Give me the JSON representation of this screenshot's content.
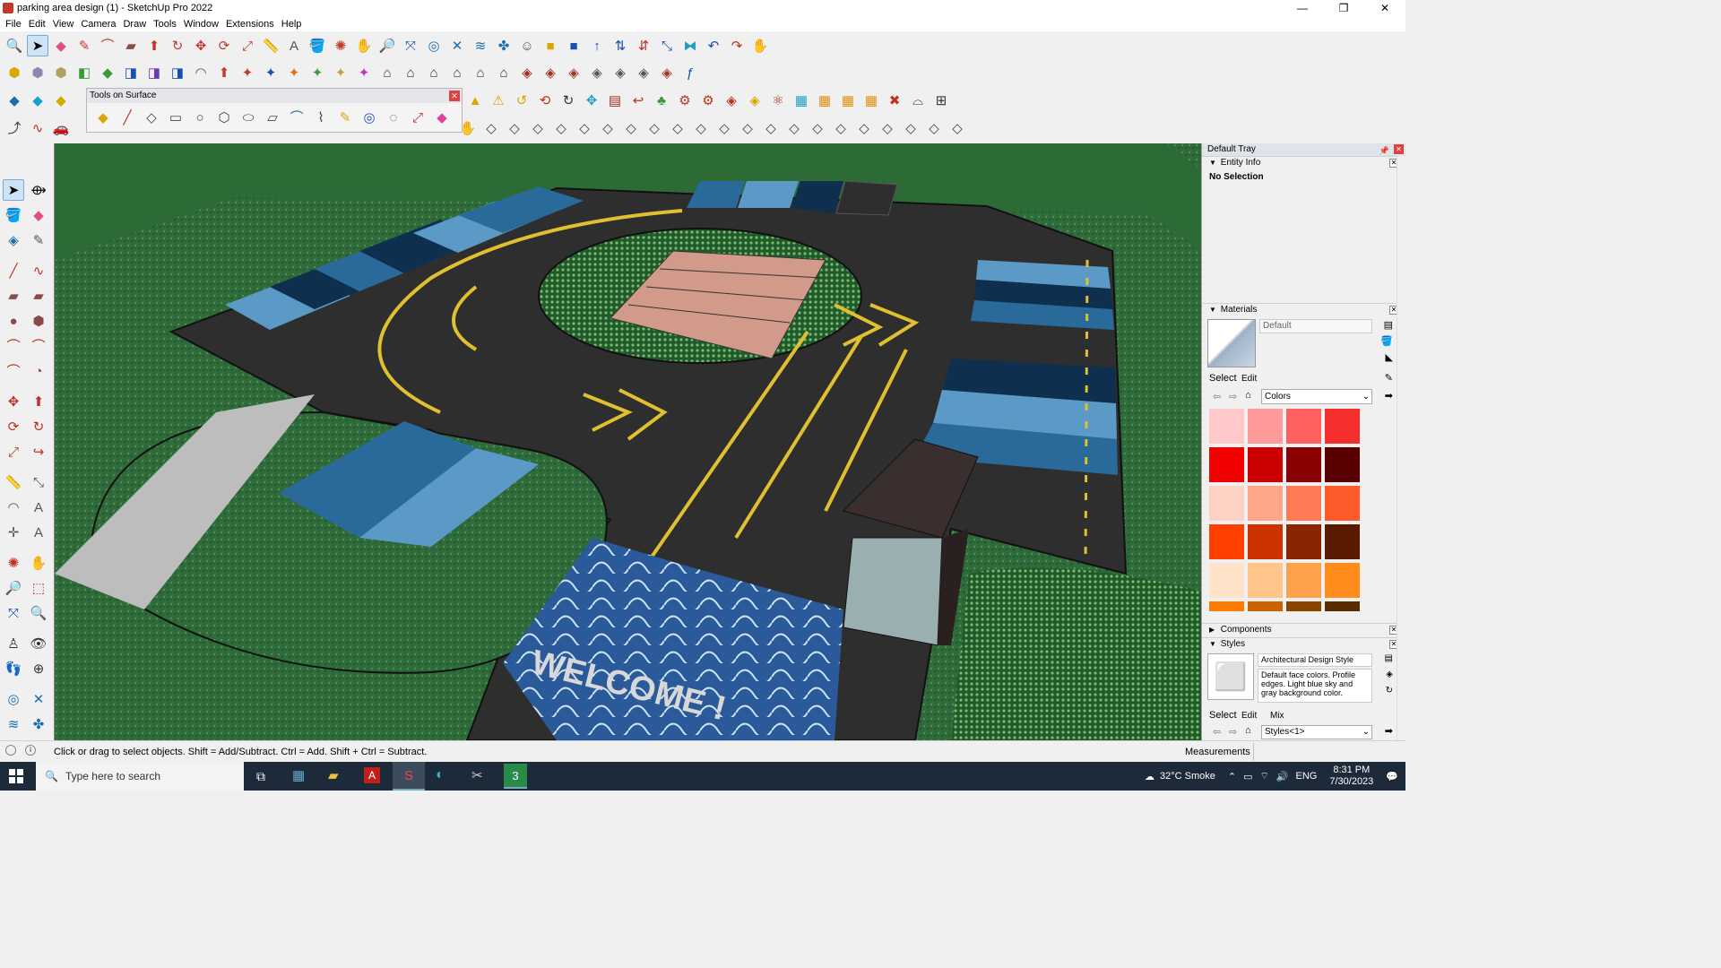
{
  "window": {
    "title": "parking area design (1) - SketchUp Pro 2022",
    "controls": [
      "—",
      "❐",
      "✕"
    ]
  },
  "menu": [
    "File",
    "Edit",
    "View",
    "Camera",
    "Draw",
    "Tools",
    "Window",
    "Extensions",
    "Help"
  ],
  "tools_on_surface": {
    "title": "Tools on Surface",
    "close": "✕"
  },
  "viewport": {
    "welcome_text": "WELCOME !"
  },
  "tray": {
    "title": "Default Tray",
    "entity_info": {
      "header": "Entity Info",
      "status": "No Selection"
    },
    "materials": {
      "header": "Materials",
      "material_name": "Default",
      "tab_select": "Select",
      "tab_edit": "Edit",
      "library": "Colors",
      "swatches": [
        "#ffc9c9",
        "#ff9a9a",
        "#ff6060",
        "#f52e2e",
        "#f40000",
        "#cc0000",
        "#8b0000",
        "#5a0000",
        "#ffd0c4",
        "#ffa58a",
        "#ff7a55",
        "#ff5a2a",
        "#ff4000",
        "#cc3300",
        "#8b2400",
        "#5a1a00",
        "#ffe3c8",
        "#ffc58a",
        "#ffa04a",
        "#ff8c1a",
        "#ff7b00",
        "#cc6200",
        "#8b4300",
        "#5a2c00"
      ]
    },
    "components": {
      "header": "Components"
    },
    "styles": {
      "header": "Styles",
      "style_name": "Architectural Design Style",
      "description": "Default face colors. Profile edges. Light blue sky and gray background color.",
      "tab_select": "Select",
      "tab_edit": "Edit",
      "tab_mix": "Mix",
      "collection": "Styles<1>"
    }
  },
  "status": {
    "hint": "Click or drag to select objects. Shift = Add/Subtract. Ctrl = Add. Shift + Ctrl = Subtract.",
    "measurements_label": "Measurements"
  },
  "taskbar": {
    "search_placeholder": "Type here to search",
    "weather": "32°C  Smoke",
    "language": "ENG",
    "time": "8:31 PM",
    "date": "7/30/2023"
  }
}
